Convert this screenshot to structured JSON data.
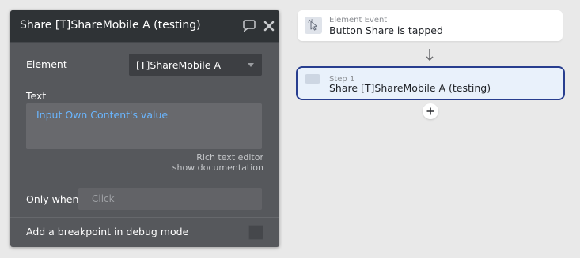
{
  "editor": {
    "title": "Share [T]ShareMobile A (testing)",
    "element_label": "Element",
    "element_value": "[T]ShareMobile A",
    "text_label": "Text",
    "text_value": "Input Own Content's value",
    "rich_text_link": "Rich text editor",
    "docs_link": "show documentation",
    "only_when_label": "Only when",
    "only_when_placeholder": "Click",
    "breakpoint_label": "Add a breakpoint in debug mode"
  },
  "workflow": {
    "event": {
      "type_label": "Element Event",
      "name": "Button Share is tapped"
    },
    "step": {
      "step_label": "Step 1",
      "name": "Share [T]ShareMobile A (testing)"
    }
  },
  "colors": {
    "panel_bg": "#56585c",
    "header_bg": "#2f3336",
    "dynamic_text": "#6ab6ff",
    "step_border": "#283e8f",
    "step_bg": "#e9f1fb"
  },
  "icons": {
    "comment": "comment-icon",
    "close": "close-icon",
    "event": "cursor-click-icon",
    "step": "step-icon",
    "arrow": "arrow-down-icon",
    "add": "plus-icon"
  }
}
